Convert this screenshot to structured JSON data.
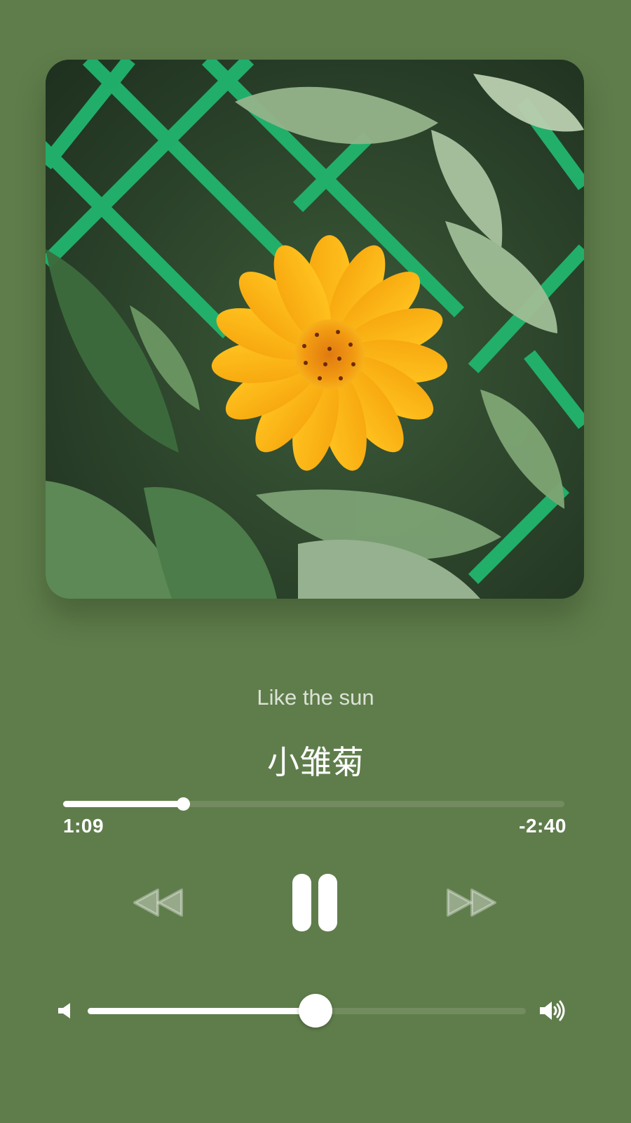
{
  "track": {
    "subtitle": "Like the sun",
    "title": "小雏菊"
  },
  "artwork": {
    "alt": "Yellow daisy flower in front of green leaves and a green wire fence"
  },
  "playback": {
    "elapsed": "1:09",
    "remaining": "-2:40",
    "progress_fraction": 0.24,
    "state": "playing"
  },
  "controls": {
    "rewind_icon": "rewind-icon",
    "pause_icon": "pause-icon",
    "forward_icon": "fast-forward-icon"
  },
  "volume": {
    "level_fraction": 0.52,
    "low_icon": "speaker-low-icon",
    "high_icon": "speaker-high-icon"
  },
  "colors": {
    "background": "#5f7d4b",
    "foreground": "#ffffff"
  }
}
